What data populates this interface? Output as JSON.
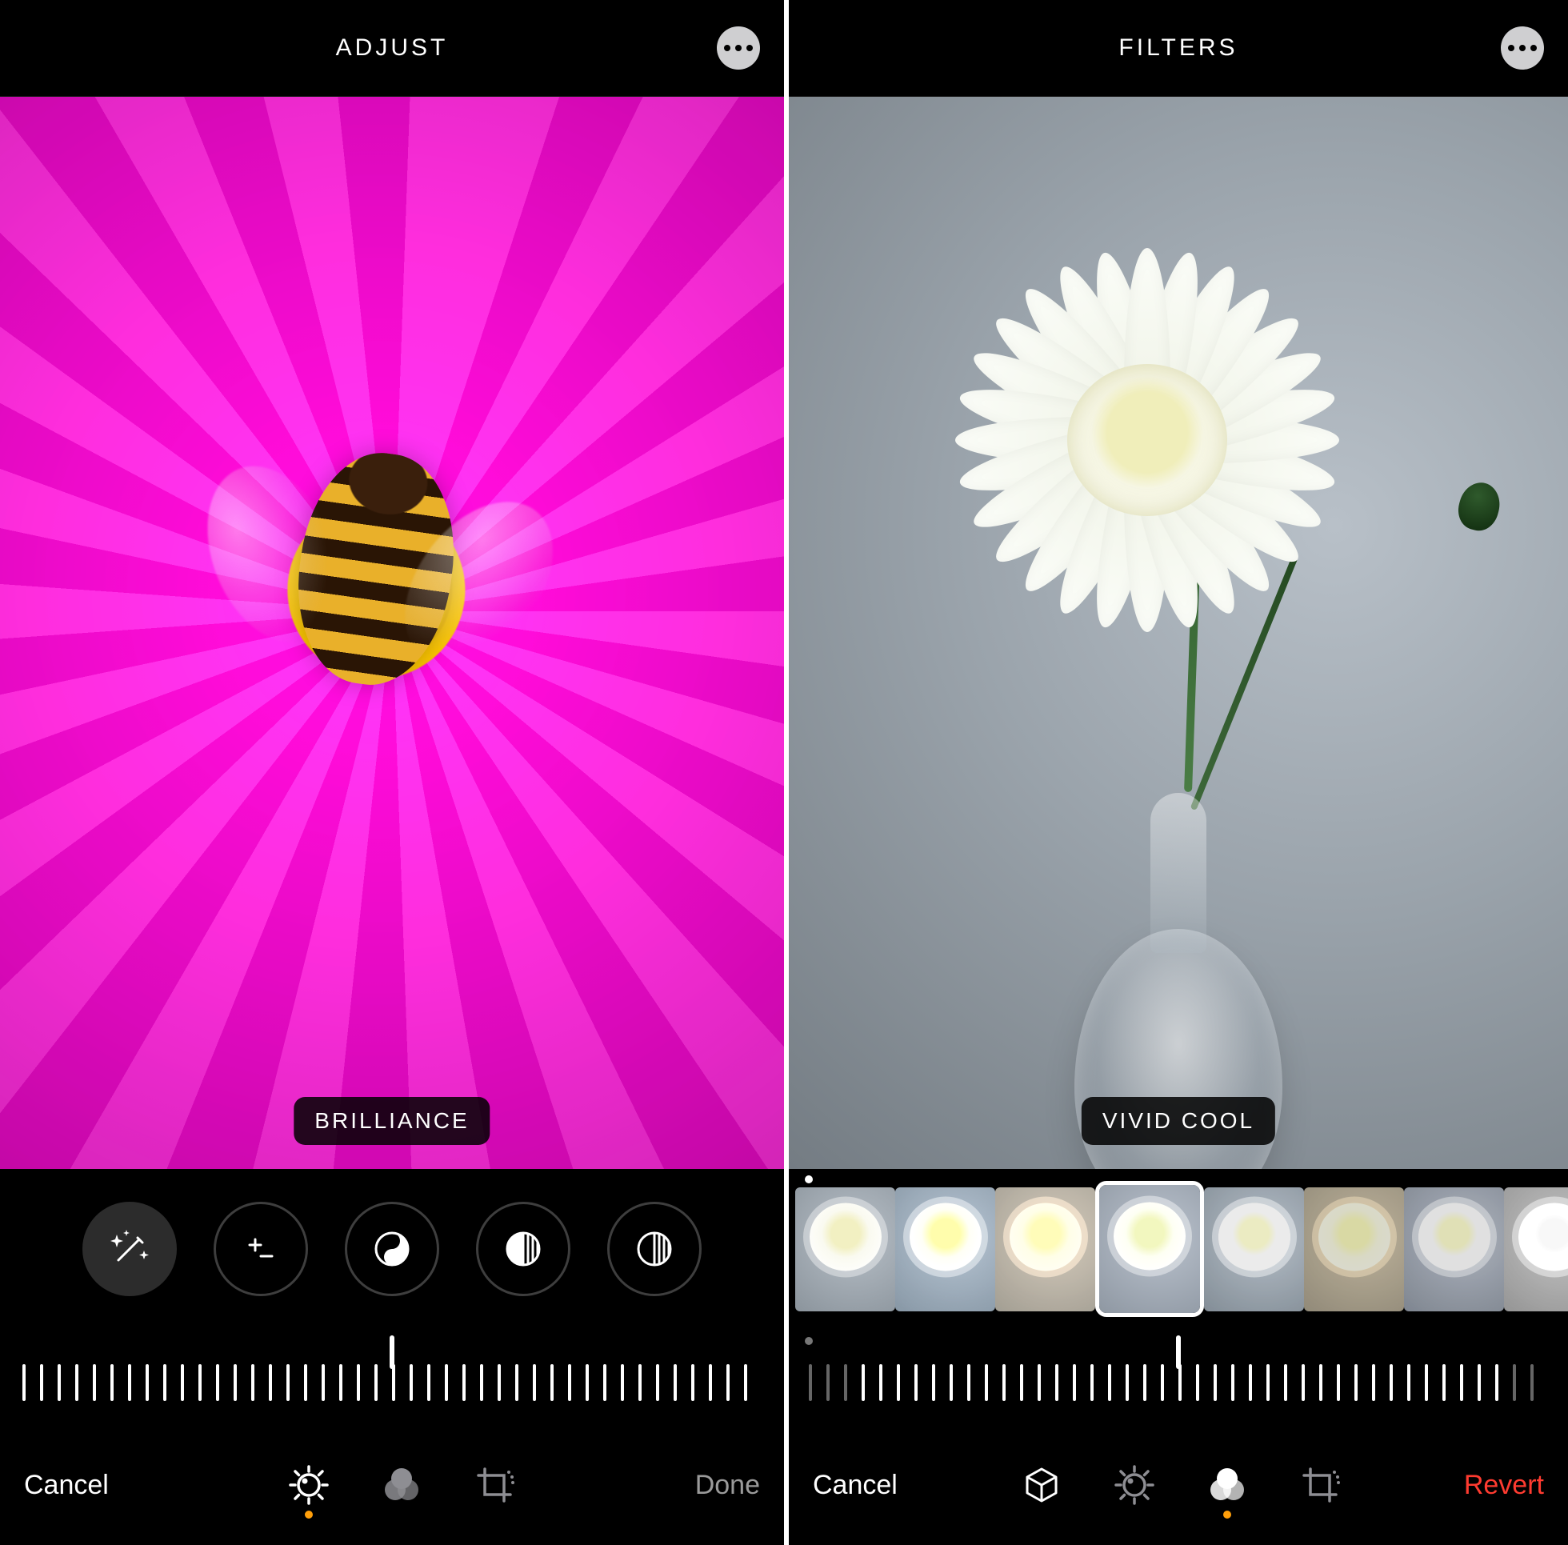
{
  "left": {
    "header": {
      "title": "ADJUST"
    },
    "badge": "BRILLIANCE",
    "adjust_buttons": [
      {
        "name": "auto",
        "icon": "wand"
      },
      {
        "name": "exposure",
        "icon": "plusminus"
      },
      {
        "name": "brilliance",
        "icon": "yinyang"
      },
      {
        "name": "highlights",
        "icon": "half-stripes"
      },
      {
        "name": "shadows",
        "icon": "half-stripes"
      }
    ],
    "bottom": {
      "cancel": "Cancel",
      "done": "Done",
      "active_tool": "adjust"
    }
  },
  "right": {
    "header": {
      "title": "FILTERS"
    },
    "badge": "VIVID COOL",
    "filters": [
      {
        "name": "original",
        "tint": "none"
      },
      {
        "name": "vivid",
        "tint": "sat"
      },
      {
        "name": "vivid-warm",
        "tint": "warm"
      },
      {
        "name": "vivid-cool",
        "tint": "cool",
        "selected": true
      },
      {
        "name": "dramatic",
        "tint": "dark"
      },
      {
        "name": "dramatic-warm",
        "tint": "warm2"
      },
      {
        "name": "dramatic-cool",
        "tint": "cool2"
      },
      {
        "name": "mono",
        "tint": "mono"
      }
    ],
    "bottom": {
      "cancel": "Cancel",
      "revert": "Revert",
      "active_tool": "filters"
    }
  },
  "colors": {
    "accent": "#ff9f0a",
    "red": "#ff3b30"
  }
}
